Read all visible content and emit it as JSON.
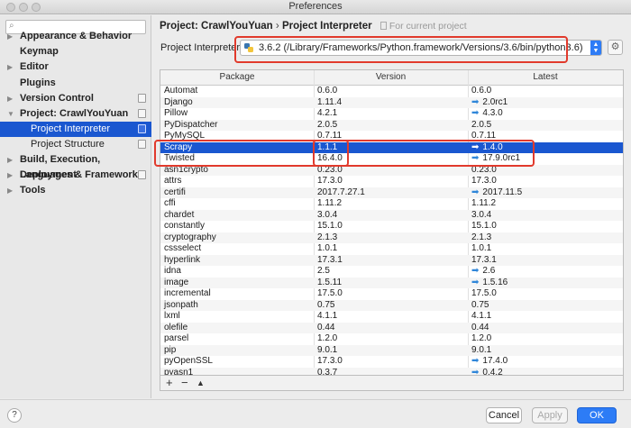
{
  "window": {
    "title": "Preferences"
  },
  "sidebar": {
    "search_placeholder": "",
    "items": [
      {
        "label": "Appearance & Behavior",
        "arrow": "▶",
        "page_icon": false
      },
      {
        "label": "Keymap",
        "arrow": "",
        "page_icon": false
      },
      {
        "label": "Editor",
        "arrow": "▶",
        "page_icon": false
      },
      {
        "label": "Plugins",
        "arrow": "",
        "page_icon": false
      },
      {
        "label": "Version Control",
        "arrow": "▶",
        "page_icon": true
      },
      {
        "label": "Project: CrawlYouYuan",
        "arrow": "▼",
        "page_icon": true
      },
      {
        "label": "Project Interpreter",
        "arrow": "",
        "page_icon": true,
        "selected": true
      },
      {
        "label": "Project Structure",
        "arrow": "",
        "page_icon": true
      },
      {
        "label": "Build, Execution, Deployment",
        "arrow": "▶",
        "page_icon": false
      },
      {
        "label": "Languages & Frameworks",
        "arrow": "▶",
        "page_icon": true
      },
      {
        "label": "Tools",
        "arrow": "▶",
        "page_icon": false
      }
    ]
  },
  "breadcrumb": {
    "project": "Project: CrawlYouYuan",
    "separator": "›",
    "page": "Project Interpreter",
    "hint": "For current project"
  },
  "interpreter": {
    "label": "Project Interpreter:",
    "value": "3.6.2 (/Library/Frameworks/Python.framework/Versions/3.6/bin/python3.6)"
  },
  "table": {
    "headers": [
      "Package",
      "Version",
      "Latest"
    ],
    "rows": [
      {
        "package": "Automat",
        "version": "0.6.0",
        "latest": "0.6.0",
        "upgrade": false
      },
      {
        "package": "Django",
        "version": "1.11.4",
        "latest": "2.0rc1",
        "upgrade": true
      },
      {
        "package": "Pillow",
        "version": "4.2.1",
        "latest": "4.3.0",
        "upgrade": true
      },
      {
        "package": "PyDispatcher",
        "version": "2.0.5",
        "latest": "2.0.5",
        "upgrade": false
      },
      {
        "package": "PyMySQL",
        "version": "0.7.11",
        "latest": "0.7.11",
        "upgrade": false
      },
      {
        "package": "Scrapy",
        "version": "1.1.1",
        "latest": "1.4.0",
        "upgrade": true,
        "selected": true
      },
      {
        "package": "Twisted",
        "version": "16.4.0",
        "latest": "17.9.0rc1",
        "upgrade": true
      },
      {
        "package": "asn1crypto",
        "version": "0.23.0",
        "latest": "0.23.0",
        "upgrade": false
      },
      {
        "package": "attrs",
        "version": "17.3.0",
        "latest": "17.3.0",
        "upgrade": false
      },
      {
        "package": "certifi",
        "version": "2017.7.27.1",
        "latest": "2017.11.5",
        "upgrade": true
      },
      {
        "package": "cffi",
        "version": "1.11.2",
        "latest": "1.11.2",
        "upgrade": false
      },
      {
        "package": "chardet",
        "version": "3.0.4",
        "latest": "3.0.4",
        "upgrade": false
      },
      {
        "package": "constantly",
        "version": "15.1.0",
        "latest": "15.1.0",
        "upgrade": false
      },
      {
        "package": "cryptography",
        "version": "2.1.3",
        "latest": "2.1.3",
        "upgrade": false
      },
      {
        "package": "cssselect",
        "version": "1.0.1",
        "latest": "1.0.1",
        "upgrade": false
      },
      {
        "package": "hyperlink",
        "version": "17.3.1",
        "latest": "17.3.1",
        "upgrade": false
      },
      {
        "package": "idna",
        "version": "2.5",
        "latest": "2.6",
        "upgrade": true
      },
      {
        "package": "image",
        "version": "1.5.11",
        "latest": "1.5.16",
        "upgrade": true
      },
      {
        "package": "incremental",
        "version": "17.5.0",
        "latest": "17.5.0",
        "upgrade": false
      },
      {
        "package": "jsonpath",
        "version": "0.75",
        "latest": "0.75",
        "upgrade": false
      },
      {
        "package": "lxml",
        "version": "4.1.1",
        "latest": "4.1.1",
        "upgrade": false
      },
      {
        "package": "olefile",
        "version": "0.44",
        "latest": "0.44",
        "upgrade": false
      },
      {
        "package": "parsel",
        "version": "1.2.0",
        "latest": "1.2.0",
        "upgrade": false
      },
      {
        "package": "pip",
        "version": "9.0.1",
        "latest": "9.0.1",
        "upgrade": false
      },
      {
        "package": "pyOpenSSL",
        "version": "17.3.0",
        "latest": "17.4.0",
        "upgrade": true
      },
      {
        "package": "pyasn1",
        "version": "0.3.7",
        "latest": "0.4.2",
        "upgrade": true
      }
    ],
    "toolbar": {
      "add": "+",
      "remove": "−",
      "upgrade": "▲"
    }
  },
  "footer": {
    "help": "?",
    "cancel": "Cancel",
    "apply": "Apply",
    "ok": "OK"
  },
  "colors": {
    "selection": "#1a57d0",
    "highlight_box": "#e13a2c",
    "upgrade_arrow": "#2f86d9",
    "primary_button": "#2d7cf6"
  }
}
